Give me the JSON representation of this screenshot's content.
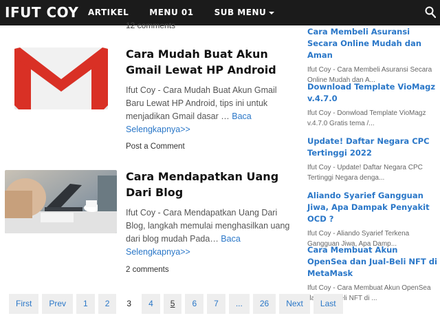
{
  "header": {
    "logo": "IFUT COY",
    "nav": [
      "ARTIKEL",
      "MENU 01",
      "SUB MENU"
    ],
    "search_icon": "search-icon",
    "bg_color": "#1b1b1b"
  },
  "top_cut": "12 comments",
  "posts": [
    {
      "title": "Cara Mudah Buat Akun Gmail Lewat HP Android",
      "snippet": "Ifut Coy - Cara Mudah Buat Akun Gmail Baru Lewat HP Android, tips ini untuk menjadikan Gmail dasar",
      "ellipsis": " … ",
      "read_more": "Baca Selengkapnya>>",
      "comments": "Post a Comment",
      "thumb_icon": "gmail-logo"
    },
    {
      "title": "Cara Mendapatkan Uang Dari Blog",
      "snippet": "Ifut Coy - Cara Mendapatkan Uang Dari Blog, langkah memulai menghasilkan uang dari blog mudah Pada",
      "ellipsis": "… ",
      "read_more": "Baca Selengkapnya>>",
      "comments": "2 comments",
      "thumb_icon": "laptop-photo"
    }
  ],
  "sidebar": [
    {
      "title": "Cara Membeli Asuransi Secara Online Mudah dan Aman",
      "snippet": "Ifut Coy - Cara Membeli Asuransi Secara Online Mudah dan A..."
    },
    {
      "title": "Download Template VioMagz v.4.7.0",
      "snippet": "Ifut Coy - Donwload Template VioMagz v.4.7.0 Gratis tema /..."
    },
    {
      "title": "Update! Daftar Negara CPC Tertinggi 2022",
      "snippet": "Ifut Coy - Update! Daftar Negara CPC Tertinggi Negara denga..."
    },
    {
      "title": "Aliando Syarief Gangguan Jiwa, Apa Dampak Penyakit OCD ?",
      "snippet": "Ifut Coy - Aliando Syarief Terkena Gangguan Jiwa, Apa Damp..."
    },
    {
      "title": "Cara Membuat Akun OpenSea dan Jual-Beli NFT di MetaMask",
      "snippet": "Ifut Coy - Cara Membuat Akun OpenSea dan Jual-Beli NFT di ..."
    }
  ],
  "pagination": {
    "items": [
      "First",
      "Prev",
      "1",
      "2",
      "3",
      "4",
      "5",
      "6",
      "7",
      "...",
      "26",
      "Next",
      "Last"
    ],
    "current": "3"
  },
  "colors": {
    "link": "#2a77c8",
    "gmail_red": "#d93025"
  }
}
